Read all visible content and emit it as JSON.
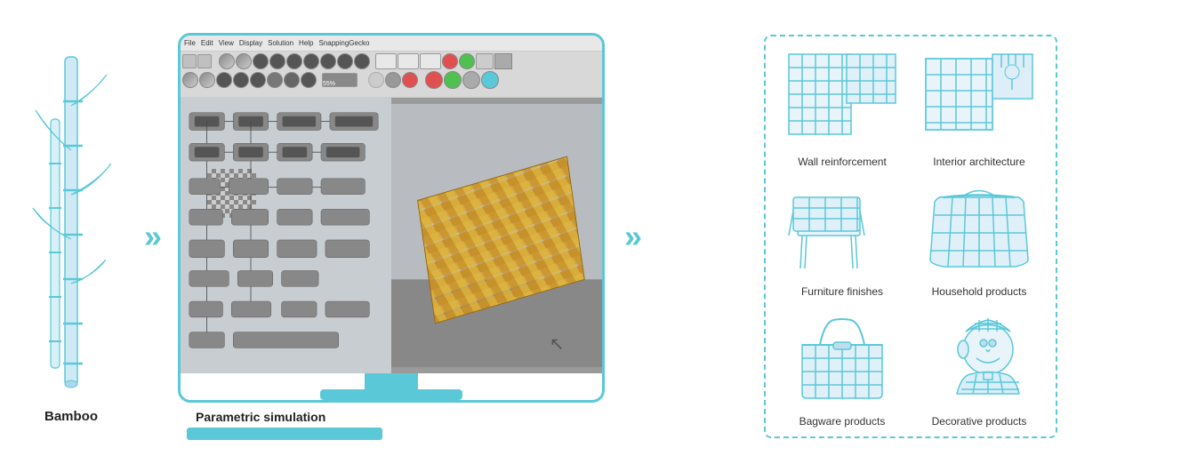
{
  "bamboo": {
    "label": "Bamboo"
  },
  "simulation": {
    "label": "Parametric simulation"
  },
  "products": [
    {
      "id": "wall-reinforcement",
      "caption": "Wall reinforcement"
    },
    {
      "id": "interior-architecture",
      "caption": "Interior architecture"
    },
    {
      "id": "furniture-finishes",
      "caption": "Furniture finishes"
    },
    {
      "id": "household-products",
      "caption": "Household products"
    },
    {
      "id": "bagware-products",
      "caption": "Bagware products"
    },
    {
      "id": "decorative-products",
      "caption": "Decorative products"
    }
  ],
  "menubar": {
    "items": [
      "File",
      "Edit",
      "View",
      "Display",
      "Solution",
      "Help",
      "SnappingGecko"
    ]
  }
}
